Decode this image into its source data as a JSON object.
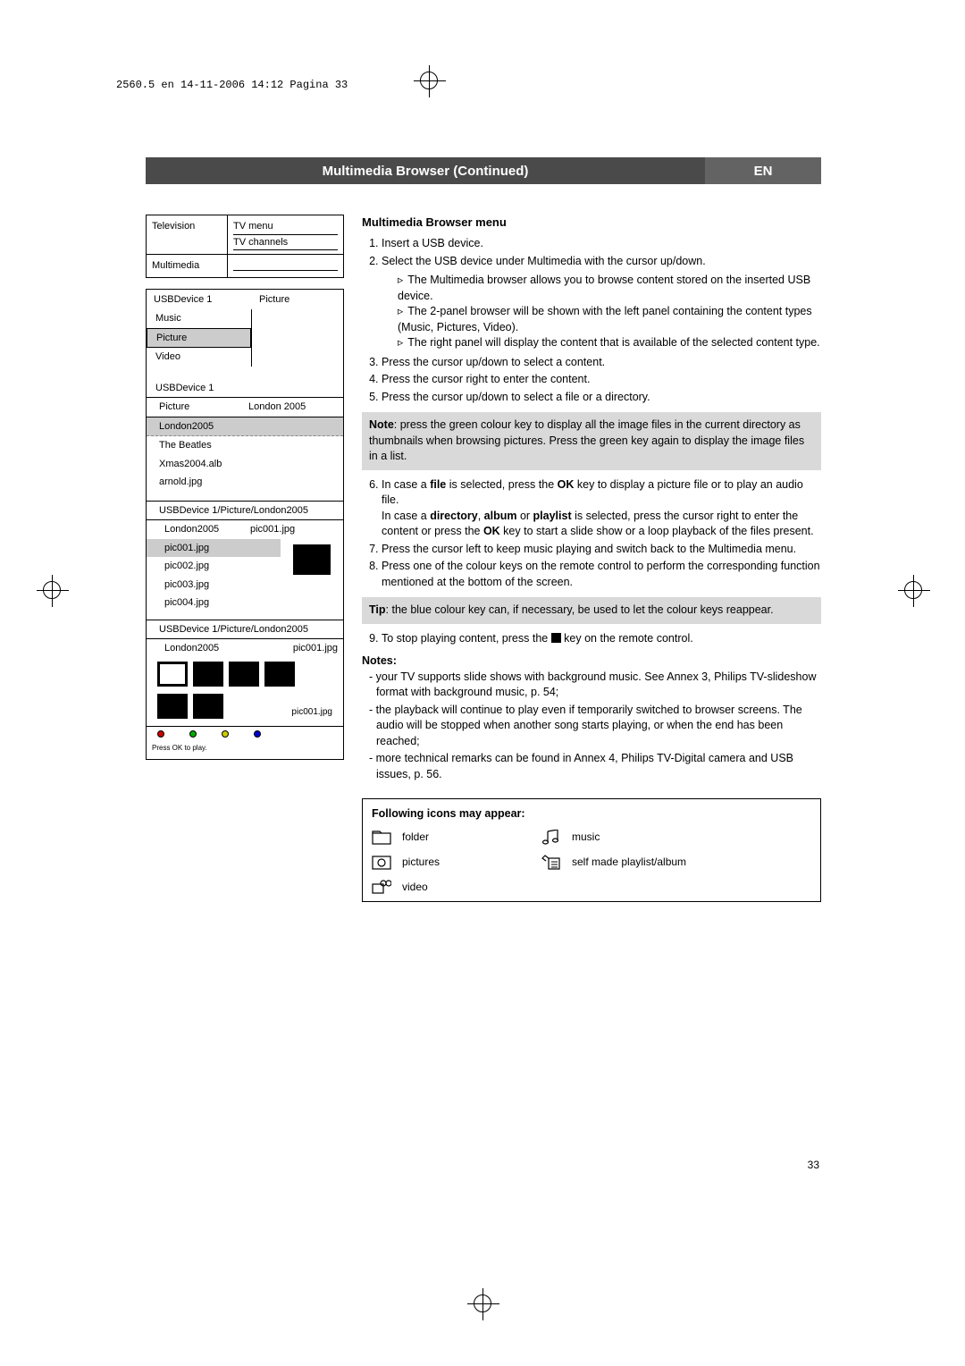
{
  "header_note": "2560.5 en  14-11-2006  14:12  Pagina 33",
  "title": "Multimedia Browser  (Continued)",
  "lang": "EN",
  "panel1": {
    "l1": "Television",
    "r1a": "TV menu",
    "r1b": "TV channels",
    "l2": "Multimedia"
  },
  "panel2": {
    "title": "USBDevice 1",
    "rtitle": "Picture",
    "items": [
      "Music",
      "Picture",
      "Video"
    ],
    "sub_title": "USBDevice 1",
    "sub_l": "Picture",
    "sub_r": "London 2005",
    "sub_items": [
      "London2005",
      "The Beatles",
      "Xmas2004.alb",
      "arnold.jpg"
    ],
    "crumb1": "USBDevice 1/Picture/London2005",
    "c1_l": "London2005",
    "c1_r": "pic001.jpg",
    "c1_items": [
      "pic001.jpg",
      "pic002.jpg",
      "pic003.jpg",
      "pic004.jpg"
    ],
    "crumb2": "USBDevice 1/Picture/London2005",
    "c2_l": "London2005",
    "c2_r": "pic001.jpg",
    "c2_hint": "pic001.jpg",
    "press_ok": "Press OK to play."
  },
  "section_title": "Multimedia Browser menu",
  "steps": {
    "s1": "Insert a USB device.",
    "s2": "Select the USB device under Multimedia with the cursor up/down.",
    "s2a": "The Multimedia browser allows you to browse content stored on the inserted USB device.",
    "s2b": "The 2-panel browser will be shown with the left panel containing the content types (Music, Pictures, Video).",
    "s2c": "The right panel will display the content that is available of the selected content type.",
    "s3": "Press the cursor up/down to select a content.",
    "s4": "Press the cursor right to enter the content.",
    "s5": "Press the cursor up/down to select a file or a directory."
  },
  "note1_pre": "Note",
  "note1": ": press the green colour key to display all the image files in the current directory as thumbnails when browsing pictures. Press the green key again to display the image files in a list.",
  "steps2": {
    "s6a": "In case a ",
    "s6b": "file",
    "s6c": " is selected, press the ",
    "s6d": "OK",
    "s6e": " key to display a picture file or to play an audio file.",
    "s6f": "In case a ",
    "s6g": "directory",
    "s6h": ", ",
    "s6i": "album",
    "s6j": " or ",
    "s6k": "playlist",
    "s6l": " is selected, press the cursor right to enter the content or press the ",
    "s6m": "OK",
    "s6n": " key to start a slide show or a loop playback of the files present.",
    "s7": "Press the cursor left to keep music playing and switch back to the Multimedia menu.",
    "s8": "Press one of the colour keys on the remote control to perform the corresponding function mentioned at the bottom of the screen."
  },
  "tip_pre": "Tip",
  "tip": ": the blue colour key can, if necessary, be used to let the colour keys reappear.",
  "s9a": "To stop playing content, press the ",
  "s9b": " key on the remote control.",
  "notes_hdr": "Notes",
  "notes": {
    "n1": "- your TV supports slide shows with background music. See Annex 3, Philips TV-slideshow format with background music, p. 54;",
    "n2": "- the playback will continue to play even if temporarily switched to browser screens. The audio will be stopped when another song starts playing, or when the end has been reached;",
    "n3": "- more technical remarks can be found in Annex 4, Philips TV-Digital camera and USB issues, p. 56."
  },
  "icons": {
    "hdr": "Following icons may appear:",
    "folder": "folder",
    "music": "music",
    "pictures": "pictures",
    "playlist": "self made playlist/album",
    "video": "video"
  },
  "page": "33"
}
